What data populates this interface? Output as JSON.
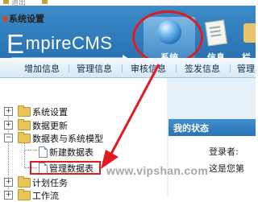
{
  "browser_strip": {
    "text": "退出"
  },
  "header": {
    "logo_first": "E",
    "logo_rest": "mpireCMS",
    "nav": [
      {
        "label": "系统",
        "icon": "globe-icon",
        "active": true
      },
      {
        "label": "信息",
        "icon": "document-icon"
      },
      {
        "label": "栏",
        "icon": "column-icon"
      }
    ]
  },
  "submenu": [
    "增加信息",
    "管理信息",
    "审核信息",
    "签发信息",
    "管理"
  ],
  "tree": {
    "title": "系统设置",
    "items": [
      {
        "label": "系统设置",
        "toggle": "+"
      },
      {
        "label": "数据更新",
        "toggle": "+"
      },
      {
        "label": "数据表与系统模型",
        "toggle": "−",
        "children": [
          "新建数据表",
          "管理数据表"
        ]
      },
      {
        "label": "计划任务",
        "toggle": "+"
      },
      {
        "label": "工作流",
        "toggle": "+"
      }
    ]
  },
  "status": {
    "title": "我的状态",
    "login_label": "登录者:",
    "line2": "这是您第"
  },
  "watermark": "www.vipshan.com",
  "colors": {
    "header_blue": "#2a72b3",
    "highlight_red": "#e11b22"
  }
}
